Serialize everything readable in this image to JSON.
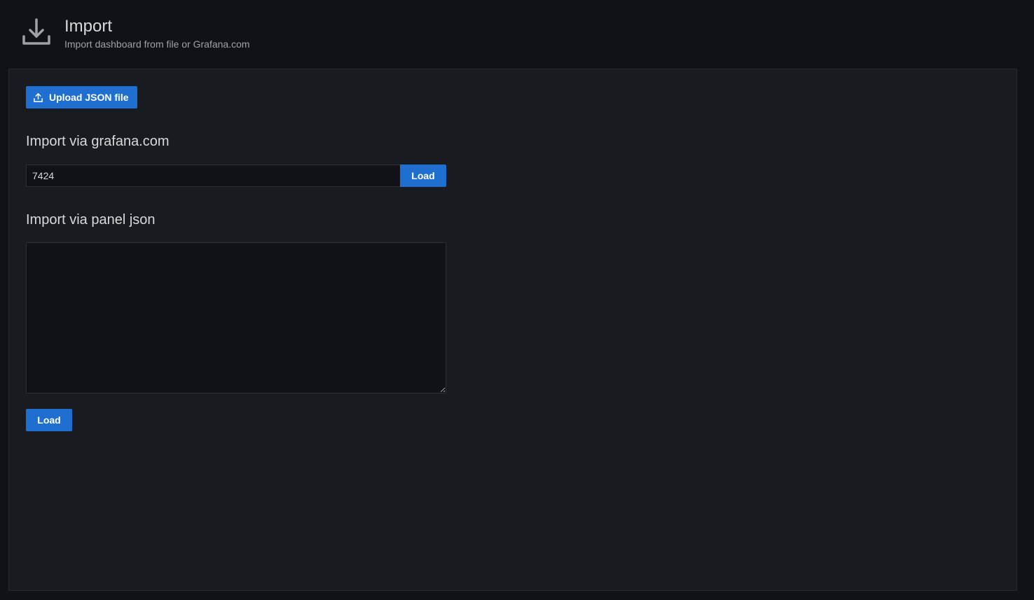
{
  "header": {
    "icon": "download-icon",
    "title": "Import",
    "subtitle": "Import dashboard from file or Grafana.com"
  },
  "upload": {
    "icon": "upload-icon",
    "label": "Upload JSON file"
  },
  "grafana_import": {
    "heading": "Import via grafana.com",
    "input_value": "7424",
    "load_label": "Load"
  },
  "panel_json_import": {
    "heading": "Import via panel json",
    "textarea_value": "",
    "load_label": "Load"
  },
  "colors": {
    "primary_button": "#1f6fd1",
    "panel_background": "#181b1f",
    "page_background": "#111217"
  }
}
